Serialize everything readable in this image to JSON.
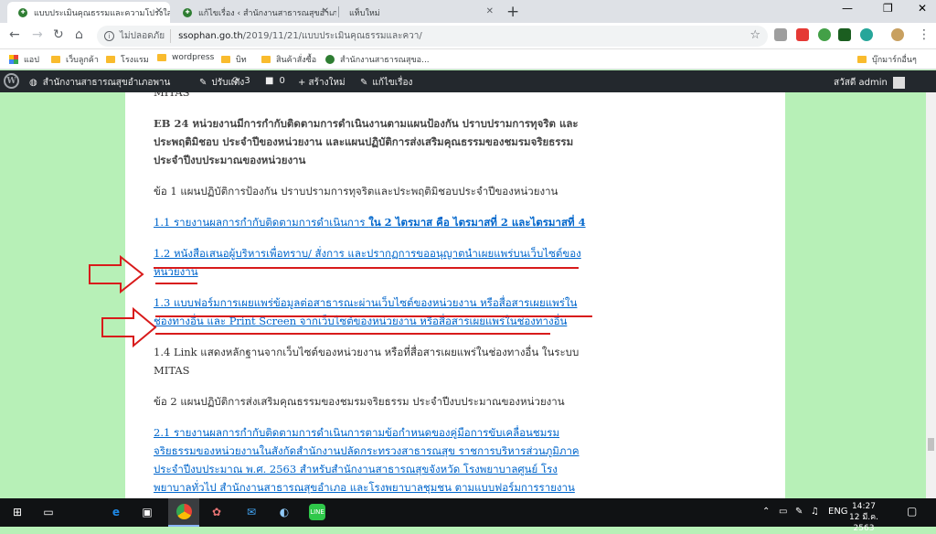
{
  "browser": {
    "tabs": [
      {
        "title": "แบบประเมินคุณธรรมและความโปร่งใสของ"
      },
      {
        "title": "แก้ไขเรื่อง ‹ สำนักงานสาธารณสุขอำเภ"
      },
      {
        "title": "แท็บใหม่"
      }
    ],
    "address": {
      "insecure_label": "ไม่ปลอดภัย",
      "domain": "ssophan.go.th",
      "path": "/2019/11/21/แบบประเมินคุณธรรมและควา/"
    },
    "bookmarks": [
      "แอป",
      "เว็บลูกค้า",
      "โรงแรม",
      "wordpress",
      "บิท",
      "สินค้าสั่งซื้อ",
      "สำนักงานสาธารณสุขอ...",
      "บุ๊กมาร์กอื่นๆ"
    ]
  },
  "wp_admin_bar": {
    "site_name": "สำนักงานสาธารณสุขอำเภอพาน",
    "customize": "ปรับแต่ง",
    "updates_count": "3",
    "comments_count": "0",
    "new_label": "+ สร้างใหม่",
    "edit_label": "แก้ไขเรื่อง",
    "greeting": "สวัสดี admin"
  },
  "content": {
    "mitas_top": "MITAS",
    "eb24": "EB 24 หน่วยงานมีการกำกับติดตามการดำเนินงานตามแผนป้องกัน ปราบปรามการทุจริต และประพฤติมิชอบ ประจำปีของหน่วยงาน และแผนปฏิบัติการส่งเสริมคุณธรรมของชมรมจริยธรรมประจำปีงบประมาณของหน่วยงาน",
    "item1": "ข้อ 1 แผนปฏิบัติการป้องกัน ปราบปรามการทุจริตและประพฤติมิชอบประจำปีของหน่วยงาน",
    "link11_a": "1.1 รายงานผลการกำกับติดตามการดำเนินการ ",
    "link11_b": "ใน 2 ไตรมาส คือ ไตรมาสที่ 2 และไตรมาสที่ 4",
    "link12": "1.2 หนังสือเสนอผู้บริหารเพื่อทราบ/ สั่งการ และปรากฏการขออนุญาตนำเผยแพร่บนเว็บไซต์ของหน่วยงาน",
    "link13": "1.3 แบบฟอร์มการเผยแพร่ข้อมูลต่อสาธารณะผ่านเว็บไซต์ของหน่วยงาน หรือสื่อสารเผยแพร่ในช่องทางอื่น และ Print Screen จากเว็บไซต์ของหน่วยงาน หรือสื่อสารเผยแพร่ในช่องทางอื่น",
    "item14": "1.4 Link แสดงหลักฐานจากเว็บไซต์ของหน่วยงาน หรือที่สื่อสารเผยแพร่ในช่องทางอื่น ในระบบ MITAS",
    "item2": "ข้อ 2 แผนปฏิบัติการส่งเสริมคุณธรรมของชมรมจริยธรรม ประจำปีงบประมาณของหน่วยงาน",
    "link21": "2.1 รายงานผลการกำกับติดตามการดำเนินการตามข้อกำหนดของคู่มือการขับเคลื่อนชมรมจริยธรรมของหน่วยงานในสังกัดสำนักงานปลัดกระทรวงสาธารณสุข ราชการบริหารส่วนภูมิภาค ประจำปีงบประมาณ พ.ศ. 2563 สำหรับสำนักงานสาธารณสุขจังหวัด โรงพยาบาลศูนย์ โรงพยาบาลทั่วไป สำนักงานสาธารณสุขอำเภอ และโรงพยาบาลชุมชน ตามแบบฟอร์มการรายงานและการติดตามประ"
  },
  "taskbar": {
    "lang": "ENG",
    "time": "14:27",
    "date": "12 มี.ค. 2563"
  },
  "colors": {
    "page_bg": "#b7f0b7",
    "link": "#0066cc",
    "annotation_red": "#d81b1b",
    "wp_bar": "#23282d"
  }
}
